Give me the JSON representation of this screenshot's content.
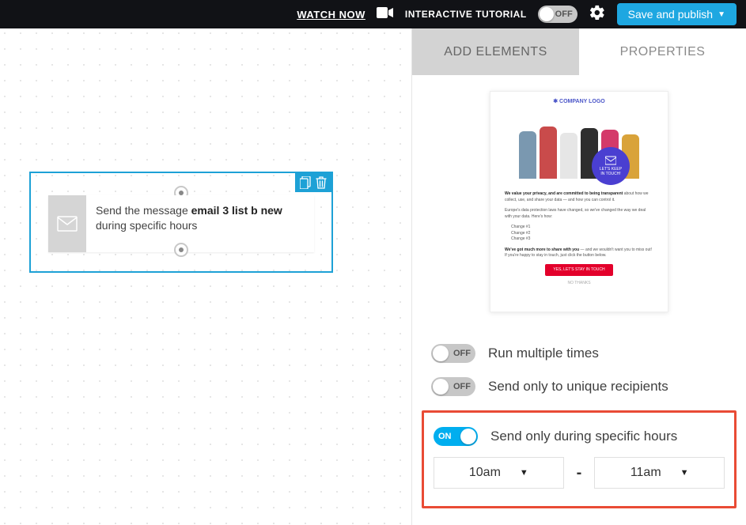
{
  "topbar": {
    "watch_now": "WATCH NOW",
    "tutorial_label": "INTERACTIVE TUTORIAL",
    "tutorial_toggle": "OFF",
    "save_button": "Save and publish"
  },
  "tabs": {
    "add_elements": "ADD ELEMENTS",
    "properties": "PROPERTIES"
  },
  "canvas_node": {
    "text_prefix": "Send the message ",
    "text_bold": "email 3 list b new",
    "text_suffix": " during specific hours"
  },
  "preview": {
    "company": "✱ COMPANY LOGO",
    "badge_line1": "LET'S KEEP",
    "badge_line2": "IN TOUCH!",
    "p1_bold": "We value your privacy, and are committed to being transparent",
    "p1_rest": " about how we collect, use, and share your data — and how you can control it.",
    "p2": "Europe's data protection laws have changed, so we've changed the way we deal with your data. Here's how:",
    "li1": "Change #1",
    "li2": "Change #2",
    "li3": "Change #3",
    "p3_bold": "We've got much more to share with you",
    "p3_rest": " — and we wouldn't want you to miss out! If you're happy to stay in touch, just click the button below.",
    "cta": "YES, LET'S STAY IN TOUCH",
    "footer": "NO THANKS"
  },
  "properties": {
    "run_multiple": {
      "toggle": "OFF",
      "label": "Run multiple times"
    },
    "unique_recipients": {
      "toggle": "OFF",
      "label": "Send only to unique recipients"
    },
    "specific_hours": {
      "toggle": "ON",
      "label": "Send only during specific hours"
    },
    "time_from": "10am",
    "time_to": "11am"
  }
}
